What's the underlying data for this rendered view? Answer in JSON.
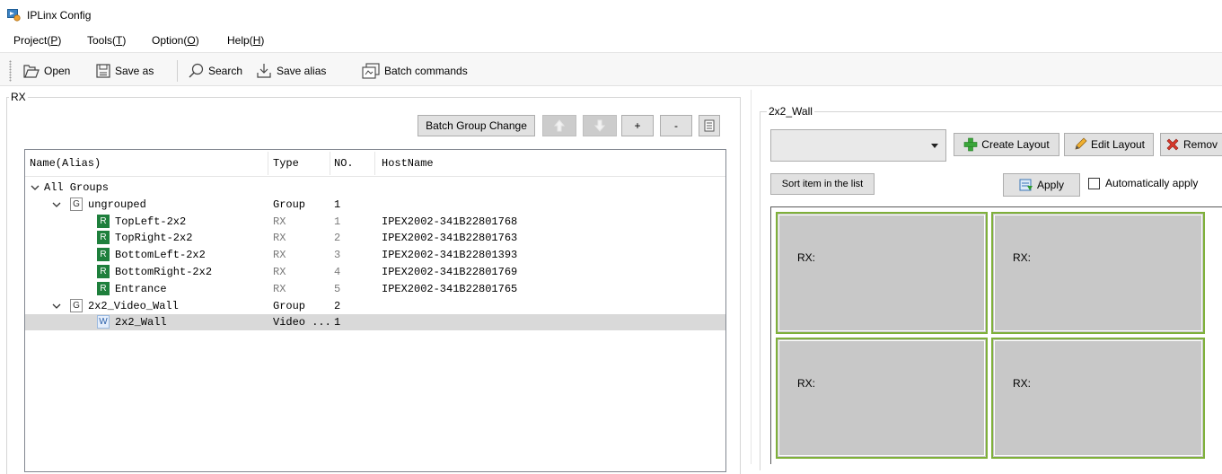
{
  "window": {
    "title": "IPLinx Config"
  },
  "menu": [
    {
      "pre": "Project(",
      "key": "P",
      "post": ")"
    },
    {
      "pre": "Tools(",
      "key": "T",
      "post": ")"
    },
    {
      "pre": "Option(",
      "key": "O",
      "post": ")"
    },
    {
      "pre": "Help(",
      "key": "H",
      "post": ")"
    }
  ],
  "toolbar": {
    "open": "Open",
    "save_as": "Save as",
    "search": "Search",
    "save_alias": "Save alias",
    "batch_commands": "Batch commands"
  },
  "rx_panel": {
    "title": "RX",
    "batch_group_change": "Batch Group Change",
    "plus": "+",
    "minus": "-",
    "columns": [
      "Name(Alias)",
      "Type",
      "NO.",
      "HostName"
    ],
    "rows": [
      {
        "level": 0,
        "expand": true,
        "badge": "",
        "name": "All Groups",
        "type": "",
        "no": "",
        "host": "",
        "dim": false
      },
      {
        "level": 1,
        "expand": true,
        "badge": "G",
        "name": "ungrouped",
        "type": "Group",
        "no": "1",
        "host": "",
        "dim": false
      },
      {
        "level": 2,
        "expand": false,
        "badge": "R",
        "name": "TopLeft-2x2",
        "type": "RX",
        "no": "1",
        "host": "IPEX2002-341B22801768",
        "dim": true
      },
      {
        "level": 2,
        "expand": false,
        "badge": "R",
        "name": "TopRight-2x2",
        "type": "RX",
        "no": "2",
        "host": "IPEX2002-341B22801763",
        "dim": true
      },
      {
        "level": 2,
        "expand": false,
        "badge": "R",
        "name": "BottomLeft-2x2",
        "type": "RX",
        "no": "3",
        "host": "IPEX2002-341B22801393",
        "dim": true
      },
      {
        "level": 2,
        "expand": false,
        "badge": "R",
        "name": "BottomRight-2x2",
        "type": "RX",
        "no": "4",
        "host": "IPEX2002-341B22801769",
        "dim": true
      },
      {
        "level": 2,
        "expand": false,
        "badge": "R",
        "name": "Entrance",
        "type": "RX",
        "no": "5",
        "host": "IPEX2002-341B22801765",
        "dim": true
      },
      {
        "level": 1,
        "expand": true,
        "badge": "G",
        "name": "2x2_Video_Wall",
        "type": "Group",
        "no": "2",
        "host": "",
        "dim": false
      },
      {
        "level": 2,
        "expand": false,
        "badge": "W",
        "name": "2x2_Wall",
        "type": "Video ...",
        "no": "1",
        "host": "",
        "dim": false,
        "selected": true
      }
    ]
  },
  "wall_panel": {
    "title": "2x2_Wall",
    "combo_value": "",
    "create_layout": "Create Layout",
    "edit_layout": "Edit Layout",
    "remove": "Remov",
    "sort": "Sort item in the list",
    "apply": "Apply",
    "auto_apply": "Automatically apply",
    "tiles": [
      "RX:",
      "RX:",
      "RX:",
      "RX:"
    ]
  },
  "colors": {
    "badge_rx": "#1e7f3c",
    "tile_border": "#7fb03a",
    "tile_fill": "#c8c8c8",
    "selected_row": "#d9d9d9"
  }
}
